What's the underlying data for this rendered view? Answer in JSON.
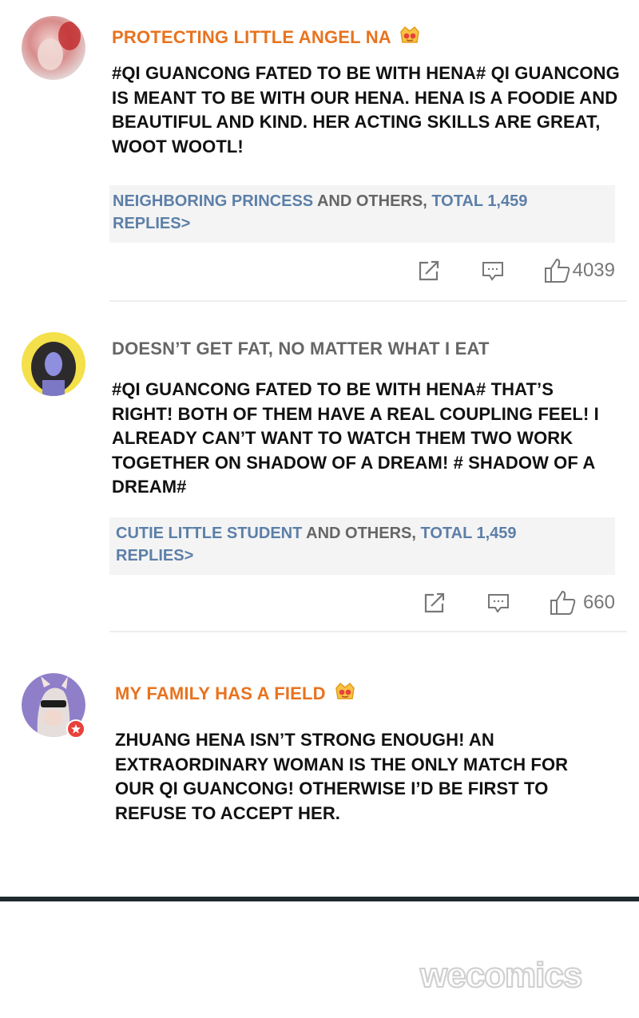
{
  "colors": {
    "username_orange": "#e8731f",
    "username_gray": "#666666",
    "link_blue": "#5c7fa8",
    "reply_bg": "#f4f4f4"
  },
  "comments": [
    {
      "username": "PROTECTING LITTLE ANGEL NA",
      "username_style": "orange",
      "badge": "crown-icon",
      "text": "#QI GUANCONG FATED TO BE WITH HENA# QI GUANCONG IS MEANT TO BE WITH OUR HENA. HENA IS A FOODIE AND BEAUTIFUL AND KIND. HER ACTING SKILLS ARE GREAT, WOOT WOOTL!",
      "replies": {
        "first_name": "NEIGHBORING PRINCESS",
        "middle": " AND OTHERS, ",
        "total": "TOTAL 1,459",
        "replies_word": "REPLIES>"
      },
      "likes": "4039"
    },
    {
      "username": "DOESN’T GET FAT, NO MATTER WHAT I EAT",
      "username_style": "gray",
      "text": "#QI GUANCONG FATED TO BE WITH HENA# THAT’S RIGHT! BOTH OF THEM HAVE A REAL COUPLING FEEL! I ALREADY CAN’T WANT TO WATCH THEM TWO WORK TOGETHER ON SHADOW OF A DREAM! # SHADOW OF A DREAM#",
      "replies": {
        "first_name": "CUTIE LITTLE STUDENT",
        "middle": " AND OTHERS, ",
        "total": "TOTAL 1,459",
        "replies_word": "REPLIES>"
      },
      "likes": "660"
    },
    {
      "username": "MY FAMILY HAS A FIELD",
      "username_style": "orange",
      "badge": "crown-icon",
      "text": "ZHUANG HENA ISN’T STRONG ENOUGH! AN EXTRAORDINARY WOMAN IS THE ONLY MATCH FOR OUR QI GUANCONG! OTHERWISE I’D BE FIRST TO REFUSE TO ACCEPT HER."
    }
  ],
  "watermark": "wecomics"
}
